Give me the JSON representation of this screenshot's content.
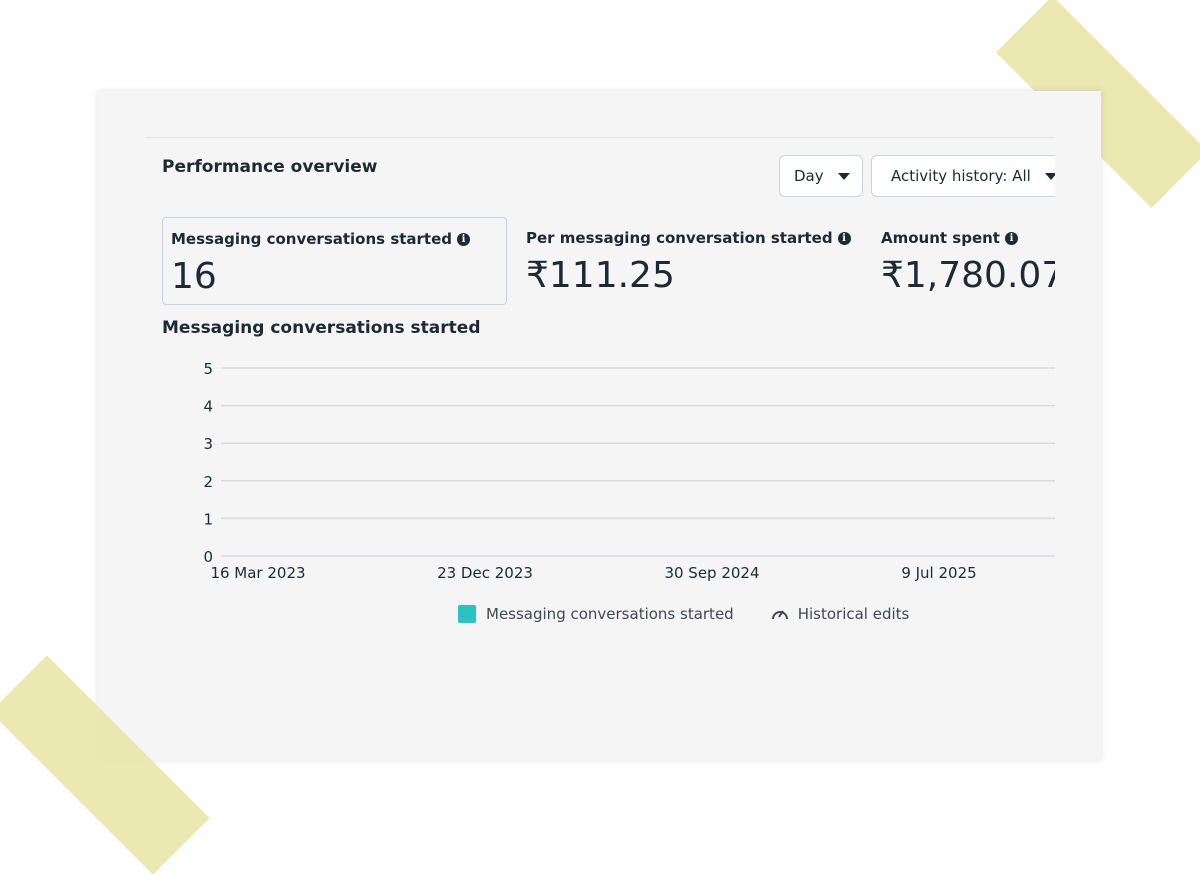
{
  "panel": {
    "title": "Performance overview",
    "granularity_dropdown": "Day",
    "activity_dropdown": "Activity history: All"
  },
  "metrics": [
    {
      "label": "Messaging conversations started",
      "value": "16"
    },
    {
      "label": "Per messaging conversation started",
      "value": "₹111.25"
    },
    {
      "label": "Amount spent",
      "value": "₹1,780.07"
    }
  ],
  "chart_title": "Messaging conversations started",
  "chart_data": {
    "type": "bar",
    "xlabel": "",
    "ylabel": "",
    "ylim": [
      0,
      5
    ],
    "yticks": [
      "0",
      "1",
      "2",
      "3",
      "4",
      "5"
    ],
    "xticks": [
      "16 Mar 2023",
      "23 Dec 2023",
      "30 Sep 2024",
      "9 Jul 2025"
    ],
    "series": [
      {
        "name": "Messaging conversations started",
        "values": [],
        "color": "#2bc3c1"
      }
    ],
    "grid": true,
    "legend": "bottom-center"
  },
  "legend": {
    "series_label": "Messaging conversations started",
    "edits_label": "Historical edits",
    "edits_icon": "historical-edits-icon"
  },
  "colors": {
    "accent": "#2bc3c1",
    "text": "#1c2b33",
    "background": "#f5f5f5"
  }
}
